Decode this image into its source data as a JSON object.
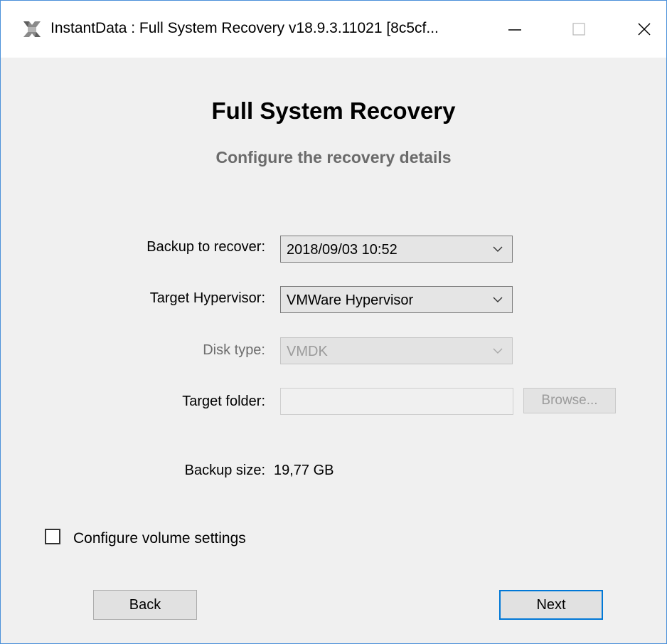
{
  "window": {
    "title": "InstantData : Full System Recovery v18.9.3.11021 [8c5cf...",
    "icon": "instantdata-logo-icon",
    "controls": [
      "minimize-icon",
      "maximize-icon",
      "close-icon"
    ]
  },
  "header": {
    "title": "Full System Recovery",
    "subtitle": "Configure the recovery details"
  },
  "form": {
    "backup": {
      "label": "Backup to recover:",
      "value": "2018/09/03 10:52"
    },
    "hypervisor": {
      "label": "Target Hypervisor:",
      "value": "VMWare Hypervisor"
    },
    "disk_type": {
      "label": "Disk type:",
      "value": "VMDK",
      "disabled": true
    },
    "target_folder": {
      "label": "Target folder:",
      "value": "",
      "browse_label": "Browse...",
      "disabled": true
    },
    "backup_size": {
      "label": "Backup size:",
      "value": "19,77 GB"
    }
  },
  "options": {
    "configure_volume": {
      "label": "Configure volume settings",
      "checked": false
    }
  },
  "buttons": {
    "back": "Back",
    "next": "Next"
  },
  "colors": {
    "accent": "#0078d7",
    "window_border": "#4a90d9",
    "subtitle": "#6b6b6b"
  }
}
